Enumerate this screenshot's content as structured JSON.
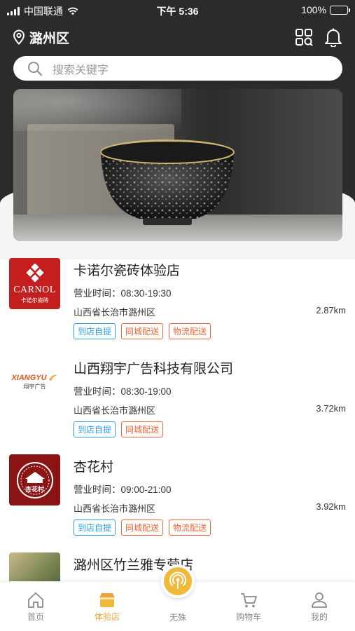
{
  "status_bar": {
    "carrier": "中国联通",
    "time": "下午 5:36",
    "battery": "100%"
  },
  "header": {
    "location": "潞州区",
    "search_placeholder": "搜索关键字"
  },
  "banner": {
    "icon": "tea-bowl-photo"
  },
  "stores": [
    {
      "name": "卡诺尔瓷砖体验店",
      "logo": {
        "brand": "CARNOL",
        "subtitle": "卡诺尔瓷砖",
        "bg": "#c41f1f"
      },
      "hours": "营业时间：08:30-19:30",
      "address": "山西省长治市潞州区",
      "distance": "2.87km",
      "tags": [
        {
          "label": "到店自提",
          "style": "blue"
        },
        {
          "label": "同城配送",
          "style": "orange"
        },
        {
          "label": "物流配送",
          "style": "orange"
        }
      ]
    },
    {
      "name": "山西翔宇广告科技有限公司",
      "logo": {
        "brand": "XIANGYU",
        "subtitle": "翔宇广告",
        "bg": "#ffffff"
      },
      "hours": "营业时间：08:30-19:00",
      "address": "山西省长治市潞州区",
      "distance": "3.72km",
      "tags": [
        {
          "label": "到店自提",
          "style": "blue"
        },
        {
          "label": "同城配送",
          "style": "orange"
        }
      ]
    },
    {
      "name": "杏花村",
      "logo": {
        "brand": "杏花村",
        "subtitle": "",
        "bg": "#8b1414"
      },
      "hours": "营业时间：09:00-21:00",
      "address": "山西省长治市潞州区",
      "distance": "3.92km",
      "tags": [
        {
          "label": "到店自提",
          "style": "blue"
        },
        {
          "label": "同城配送",
          "style": "orange"
        },
        {
          "label": "物流配送",
          "style": "orange"
        }
      ]
    },
    {
      "name": "潞州区竹兰雅专营店",
      "logo": {
        "brand": "",
        "subtitle": "",
        "bg": "#7f8a5a"
      },
      "hours": "",
      "address": "",
      "distance": "",
      "tags": []
    }
  ],
  "tabbar": {
    "home": "首页",
    "experience": "体验店",
    "center": "无殊",
    "cart": "购物车",
    "mine": "我的"
  },
  "colors": {
    "accent": "#e9a43b",
    "tag_blue": "#2ba0e8",
    "tag_orange": "#f0663a"
  }
}
